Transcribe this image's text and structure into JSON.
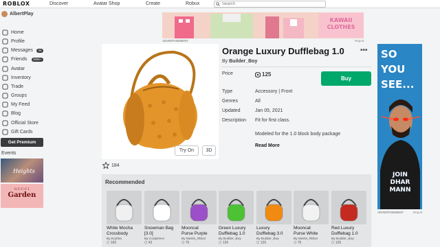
{
  "topbar": {
    "logo": "ROBLOX",
    "nav": [
      "Discover",
      "Avatar Shop",
      "Create",
      "Robux"
    ],
    "search_placeholder": "Search"
  },
  "sidebar": {
    "username": "AlbertPlay",
    "items": [
      {
        "label": "Home",
        "icon": "home-icon"
      },
      {
        "label": "Profile",
        "icon": "profile-icon"
      },
      {
        "label": "Messages",
        "icon": "messages-icon",
        "badge": "2K"
      },
      {
        "label": "Friends",
        "icon": "friends-icon",
        "badge": "180K+"
      },
      {
        "label": "Avatar",
        "icon": "avatar-icon"
      },
      {
        "label": "Inventory",
        "icon": "inventory-icon"
      },
      {
        "label": "Trade",
        "icon": "trade-icon"
      },
      {
        "label": "Groups",
        "icon": "groups-icon"
      },
      {
        "label": "My Feed",
        "icon": "feed-icon"
      },
      {
        "label": "Blog",
        "icon": "blog-icon"
      },
      {
        "label": "Official Store",
        "icon": "store-icon"
      },
      {
        "label": "Gift Cards",
        "icon": "giftcard-icon"
      }
    ],
    "premium_label": "Get Premium",
    "events_label": "Events",
    "event1_text": "Heights",
    "event2_line1": "GUCCI",
    "event2_line2": "Garden"
  },
  "ad_top": {
    "brand_line1": "KAWAII",
    "brand_line2": "CLOTHES",
    "label": "ADVERTISEMENT",
    "report": "Report"
  },
  "item": {
    "title": "Orange Luxury Dufflebag 1.0",
    "by_prefix": "By ",
    "creator": "Builder_Boy",
    "price_label": "Price",
    "price": "125",
    "buy_label": "Buy",
    "type_label": "Type",
    "type_value": "Accessory | Front",
    "genres_label": "Genres",
    "genres_value": "All",
    "updated_label": "Updated",
    "updated_value": "Jan 05, 2021",
    "description_label": "Description",
    "description_line1": "Fit for first class.",
    "description_line2": "Modeled for the 1.0 block body package",
    "read_more": "Read More",
    "try_on": "Try On",
    "three_d": "3D",
    "favorites": "184"
  },
  "ad_right": {
    "headline_line1": "SO",
    "headline_line2": "YOU",
    "headline_line3": "SEE...",
    "footer_line1": "JOIN",
    "footer_line2": "DHAR",
    "footer_line3": "MANN",
    "label": "ADVERTISEMENT",
    "report": "Report"
  },
  "recommended": {
    "title": "Recommended",
    "items": [
      {
        "name_line1": "White Mocha",
        "name_line2": "Crossbody",
        "by": "By Erythia",
        "price": "150",
        "color": "#f0f0f0"
      },
      {
        "name_line1": "Snowman Bag",
        "name_line2": "[3.0]",
        "by": "By CodyDevv",
        "price": "42",
        "color": "#ffffff"
      },
      {
        "name_line1": "Mooncat",
        "name_line2": "Purse Purple",
        "by": "By Martin_Rblx2",
        "price": "75",
        "color": "#9b4fc8"
      },
      {
        "name_line1": "Green Luxury",
        "name_line2": "Dufflebag 1.0",
        "by": "By Builder_Boy",
        "price": "125",
        "color": "#4cc234"
      },
      {
        "name_line1": "Luxury",
        "name_line2": "Dufflebag 3.0",
        "by": "By Builder_Boy",
        "price": "125",
        "color": "#f08a10"
      },
      {
        "name_line1": "Mooncat",
        "name_line2": "Purse White",
        "by": "By Martin_Rblx2",
        "price": "75",
        "color": "#f2f2f2"
      },
      {
        "name_line1": "Red Luxury",
        "name_line2": "Dufflebag 1.0",
        "by": "By Builder_Boy",
        "price": "125",
        "color": "#c42a20"
      }
    ]
  },
  "colors": {
    "buy": "#00a86b",
    "bag_orange": "#e4952a",
    "ad_right_bg": "#2a86c4"
  }
}
